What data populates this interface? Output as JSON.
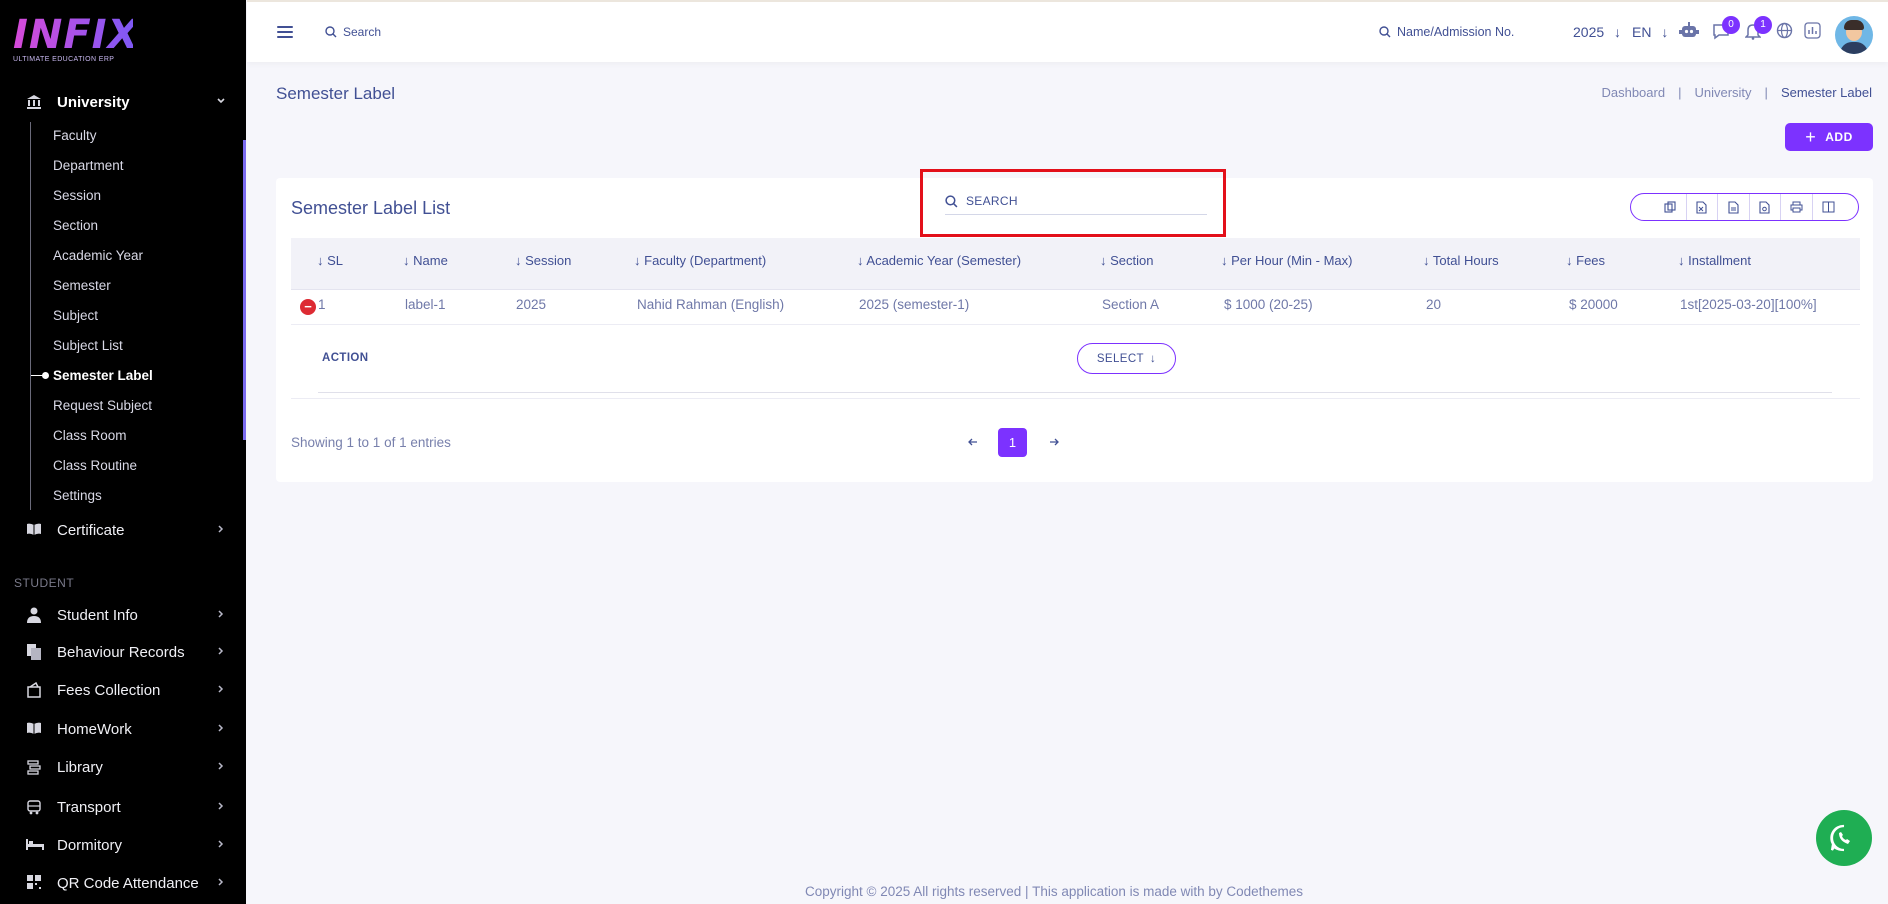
{
  "brand": {
    "logo_text": "INFIX",
    "tagline": "ULTIMATE EDUCATION ERP"
  },
  "sidebar": {
    "university": {
      "label": "University",
      "icon": "bank-icon"
    },
    "university_items": [
      {
        "label": "Faculty"
      },
      {
        "label": "Department"
      },
      {
        "label": "Session"
      },
      {
        "label": "Section"
      },
      {
        "label": "Academic Year"
      },
      {
        "label": "Semester"
      },
      {
        "label": "Subject"
      },
      {
        "label": "Subject List"
      },
      {
        "label": "Semester Label",
        "active": true
      },
      {
        "label": "Request Subject"
      },
      {
        "label": "Class Room"
      },
      {
        "label": "Class Routine"
      },
      {
        "label": "Settings"
      }
    ],
    "certificate": {
      "label": "Certificate",
      "icon": "book-icon"
    },
    "student_section": "STUDENT",
    "student_items": [
      {
        "label": "Student Info",
        "icon": "user-icon"
      },
      {
        "label": "Behaviour Records",
        "icon": "document-icon"
      },
      {
        "label": "Fees Collection",
        "icon": "wallet-icon"
      },
      {
        "label": "HomeWork",
        "icon": "book-icon"
      },
      {
        "label": "Library",
        "icon": "library-icon"
      },
      {
        "label": "Transport",
        "icon": "bus-icon"
      },
      {
        "label": "Dormitory",
        "icon": "bed-icon"
      },
      {
        "label": "QR Code Attendance",
        "icon": "qr-icon"
      }
    ]
  },
  "header": {
    "search_label": "Search",
    "admission_search": "Name/Admission No.",
    "year": "2025",
    "language": "EN",
    "messages_count": "0",
    "notifications_count": "1"
  },
  "page": {
    "title": "Semester Label",
    "breadcrumb": [
      "Dashboard",
      "University",
      "Semester Label"
    ],
    "add_label": "ADD"
  },
  "table": {
    "title": "Semester Label List",
    "search_placeholder": "SEARCH",
    "columns": [
      "SL",
      "Name",
      "Session",
      "Faculty (Department)",
      "Academic Year (Semester)",
      "Section",
      "Per Hour (Min - Max)",
      "Total Hours",
      "Fees",
      "Installment"
    ],
    "rows": [
      [
        "1",
        "label-1",
        "2025",
        "Nahid Rahman (English)",
        "2025 (semester-1)",
        "Section A",
        "$ 1000 (20-25)",
        "20",
        "$ 20000",
        "1st[2025-03-20][100%]"
      ]
    ],
    "action_label": "ACTION",
    "select_label": "SELECT",
    "showing": "Showing 1 to 1 of 1 entries",
    "current_page": "1",
    "accent": "#7c32ff"
  },
  "footer": "Copyright © 2025 All rights reserved | This application is made with by Codethemes"
}
